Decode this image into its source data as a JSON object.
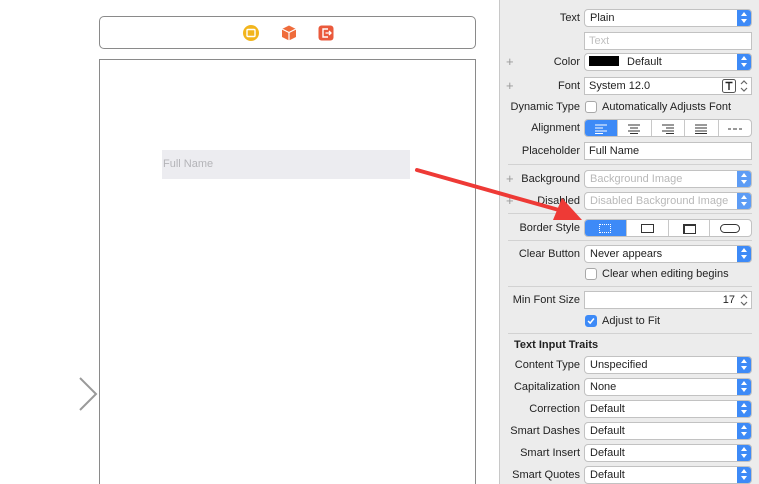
{
  "canvas": {
    "dock_icons": [
      "view-controller-icon",
      "first-responder-icon",
      "exit-icon"
    ],
    "text_field_placeholder": "Full Name"
  },
  "inspector": {
    "text": {
      "label": "Text",
      "value": "Plain",
      "sub_placeholder": "Text"
    },
    "color": {
      "label": "Color",
      "value": "Default",
      "swatch": "#000000"
    },
    "font": {
      "label": "Font",
      "value": "System 12.0"
    },
    "dynamic_type": {
      "label": "Dynamic Type",
      "checkbox_label": "Automatically Adjusts Font",
      "checked": false
    },
    "alignment": {
      "label": "Alignment",
      "options": [
        "left",
        "center",
        "right",
        "justified",
        "natural"
      ],
      "selected": "left"
    },
    "placeholder": {
      "label": "Placeholder",
      "value": "Full Name"
    },
    "background": {
      "label": "Background",
      "placeholder": "Background Image"
    },
    "disabled": {
      "label": "Disabled",
      "placeholder": "Disabled Background Image"
    },
    "border_style": {
      "label": "Border Style",
      "options": [
        "none",
        "line",
        "bezel",
        "rounded"
      ],
      "selected": "none"
    },
    "clear_button": {
      "label": "Clear Button",
      "value": "Never appears",
      "checkbox_label": "Clear when editing begins",
      "checked": false
    },
    "min_font_size": {
      "label": "Min Font Size",
      "value": "17"
    },
    "adjust_to_fit": {
      "label": "Adjust to Fit",
      "checked": true
    },
    "text_input_traits": {
      "title": "Text Input Traits",
      "content_type": {
        "label": "Content Type",
        "value": "Unspecified"
      },
      "capitalization": {
        "label": "Capitalization",
        "value": "None"
      },
      "correction": {
        "label": "Correction",
        "value": "Default"
      },
      "smart_dashes": {
        "label": "Smart Dashes",
        "value": "Default"
      },
      "smart_insert": {
        "label": "Smart Insert",
        "value": "Default"
      },
      "smart_quotes": {
        "label": "Smart Quotes",
        "value": "Default"
      }
    }
  },
  "colors": {
    "accent": "#3d8af7",
    "annotation_arrow": "#ee3a36",
    "panel_bg": "#ececec"
  }
}
